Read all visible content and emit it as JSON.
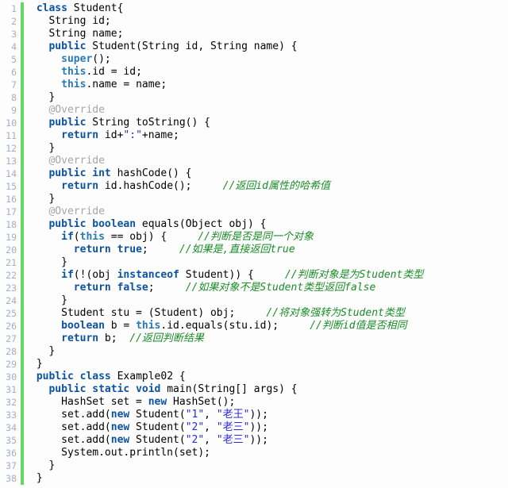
{
  "editor": {
    "name": "java-code-editor",
    "language": "Java",
    "total_lines": 38,
    "colors": {
      "background": "#fdfdfd",
      "gutter_text": "#a0b0c8",
      "change_marker": "#63d860",
      "keyword": "#0c52a3",
      "this_super": "#2b7ab5",
      "string": "#2a2ae0",
      "comment": "#1a8c28",
      "annotation": "#a6a6a6",
      "text": "#000000"
    }
  },
  "line_numbers": [
    1,
    2,
    3,
    4,
    5,
    6,
    7,
    8,
    9,
    10,
    11,
    12,
    13,
    14,
    15,
    16,
    17,
    18,
    19,
    20,
    21,
    22,
    23,
    24,
    25,
    26,
    27,
    28,
    29,
    30,
    31,
    32,
    33,
    34,
    35,
    36,
    37,
    38
  ],
  "lines": [
    {
      "n": 1,
      "tokens": [
        {
          "t": "plain",
          "v": " "
        },
        {
          "t": "kw",
          "v": "class"
        },
        {
          "t": "plain",
          "v": " Student{"
        }
      ]
    },
    {
      "n": 2,
      "tokens": [
        {
          "t": "plain",
          "v": "   String id;"
        }
      ]
    },
    {
      "n": 3,
      "tokens": [
        {
          "t": "plain",
          "v": "   String name;"
        }
      ]
    },
    {
      "n": 4,
      "tokens": [
        {
          "t": "plain",
          "v": "   "
        },
        {
          "t": "kw",
          "v": "public"
        },
        {
          "t": "plain",
          "v": " Student(String id, String name) {"
        }
      ]
    },
    {
      "n": 5,
      "tokens": [
        {
          "t": "plain",
          "v": "     "
        },
        {
          "t": "kw2",
          "v": "super"
        },
        {
          "t": "plain",
          "v": "();"
        }
      ]
    },
    {
      "n": 6,
      "tokens": [
        {
          "t": "plain",
          "v": "     "
        },
        {
          "t": "kw2",
          "v": "this"
        },
        {
          "t": "plain",
          "v": ".id = id;"
        }
      ]
    },
    {
      "n": 7,
      "tokens": [
        {
          "t": "plain",
          "v": "     "
        },
        {
          "t": "kw2",
          "v": "this"
        },
        {
          "t": "plain",
          "v": ".name = name;"
        }
      ]
    },
    {
      "n": 8,
      "tokens": [
        {
          "t": "plain",
          "v": "   }"
        }
      ]
    },
    {
      "n": 9,
      "tokens": [
        {
          "t": "plain",
          "v": "   "
        },
        {
          "t": "anno",
          "v": "@Override"
        }
      ]
    },
    {
      "n": 10,
      "tokens": [
        {
          "t": "plain",
          "v": "   "
        },
        {
          "t": "kw",
          "v": "public"
        },
        {
          "t": "plain",
          "v": " String toString() {"
        }
      ]
    },
    {
      "n": 11,
      "tokens": [
        {
          "t": "plain",
          "v": "     "
        },
        {
          "t": "kw",
          "v": "return"
        },
        {
          "t": "plain",
          "v": " id+"
        },
        {
          "t": "str",
          "v": "\":\""
        },
        {
          "t": "plain",
          "v": "+name;"
        }
      ]
    },
    {
      "n": 12,
      "tokens": [
        {
          "t": "plain",
          "v": "   }"
        }
      ]
    },
    {
      "n": 13,
      "tokens": [
        {
          "t": "plain",
          "v": "   "
        },
        {
          "t": "anno",
          "v": "@Override"
        }
      ]
    },
    {
      "n": 14,
      "tokens": [
        {
          "t": "plain",
          "v": "   "
        },
        {
          "t": "kw",
          "v": "public"
        },
        {
          "t": "plain",
          "v": " "
        },
        {
          "t": "kw",
          "v": "int"
        },
        {
          "t": "plain",
          "v": " hashCode() {"
        }
      ]
    },
    {
      "n": 15,
      "tokens": [
        {
          "t": "plain",
          "v": "     "
        },
        {
          "t": "kw",
          "v": "return"
        },
        {
          "t": "plain",
          "v": " id.hashCode();     "
        },
        {
          "t": "cmt",
          "v": "//返回id属性的哈希值"
        }
      ]
    },
    {
      "n": 16,
      "tokens": [
        {
          "t": "plain",
          "v": "   }"
        }
      ]
    },
    {
      "n": 17,
      "tokens": [
        {
          "t": "plain",
          "v": "   "
        },
        {
          "t": "anno",
          "v": "@Override"
        }
      ]
    },
    {
      "n": 18,
      "tokens": [
        {
          "t": "plain",
          "v": "   "
        },
        {
          "t": "kw",
          "v": "public"
        },
        {
          "t": "plain",
          "v": " "
        },
        {
          "t": "kw",
          "v": "boolean"
        },
        {
          "t": "plain",
          "v": " equals(Object obj) {"
        }
      ]
    },
    {
      "n": 19,
      "tokens": [
        {
          "t": "plain",
          "v": "     "
        },
        {
          "t": "kw",
          "v": "if"
        },
        {
          "t": "plain",
          "v": "("
        },
        {
          "t": "kw2",
          "v": "this"
        },
        {
          "t": "plain",
          "v": " == obj) {     "
        },
        {
          "t": "cmt",
          "v": "//判断是否是同一个对象"
        }
      ]
    },
    {
      "n": 20,
      "tokens": [
        {
          "t": "plain",
          "v": "       "
        },
        {
          "t": "kw",
          "v": "return"
        },
        {
          "t": "plain",
          "v": " "
        },
        {
          "t": "kw",
          "v": "true"
        },
        {
          "t": "plain",
          "v": ";     "
        },
        {
          "t": "cmt",
          "v": "//如果是,直接返回true"
        }
      ]
    },
    {
      "n": 21,
      "tokens": [
        {
          "t": "plain",
          "v": "     }"
        }
      ]
    },
    {
      "n": 22,
      "tokens": [
        {
          "t": "plain",
          "v": "     "
        },
        {
          "t": "kw",
          "v": "if"
        },
        {
          "t": "plain",
          "v": "(!(obj "
        },
        {
          "t": "kw",
          "v": "instanceof"
        },
        {
          "t": "plain",
          "v": " Student)) {     "
        },
        {
          "t": "cmt",
          "v": "//判断对象是为Student类型"
        }
      ]
    },
    {
      "n": 23,
      "tokens": [
        {
          "t": "plain",
          "v": "       "
        },
        {
          "t": "kw",
          "v": "return"
        },
        {
          "t": "plain",
          "v": " "
        },
        {
          "t": "kw",
          "v": "false"
        },
        {
          "t": "plain",
          "v": ";     "
        },
        {
          "t": "cmt",
          "v": "//如果对象不是Student类型返回false"
        }
      ]
    },
    {
      "n": 24,
      "tokens": [
        {
          "t": "plain",
          "v": "     }"
        }
      ]
    },
    {
      "n": 25,
      "tokens": [
        {
          "t": "plain",
          "v": "     Student stu = (Student) obj;     "
        },
        {
          "t": "cmt",
          "v": "//将对象强转为Student类型"
        }
      ]
    },
    {
      "n": 26,
      "tokens": [
        {
          "t": "plain",
          "v": "     "
        },
        {
          "t": "kw",
          "v": "boolean"
        },
        {
          "t": "plain",
          "v": " b = "
        },
        {
          "t": "kw2",
          "v": "this"
        },
        {
          "t": "plain",
          "v": ".id.equals(stu.id);     "
        },
        {
          "t": "cmt",
          "v": "//判断id值是否相同"
        }
      ]
    },
    {
      "n": 27,
      "tokens": [
        {
          "t": "plain",
          "v": "     "
        },
        {
          "t": "kw",
          "v": "return"
        },
        {
          "t": "plain",
          "v": " b;  "
        },
        {
          "t": "cmt",
          "v": "//返回判断结果"
        }
      ]
    },
    {
      "n": 28,
      "tokens": [
        {
          "t": "plain",
          "v": "   }"
        }
      ]
    },
    {
      "n": 29,
      "tokens": [
        {
          "t": "plain",
          "v": " }"
        }
      ]
    },
    {
      "n": 30,
      "tokens": [
        {
          "t": "plain",
          "v": " "
        },
        {
          "t": "kw",
          "v": "public"
        },
        {
          "t": "plain",
          "v": " "
        },
        {
          "t": "kw",
          "v": "class"
        },
        {
          "t": "plain",
          "v": " Example02 {"
        }
      ]
    },
    {
      "n": 31,
      "tokens": [
        {
          "t": "plain",
          "v": "   "
        },
        {
          "t": "kw",
          "v": "public"
        },
        {
          "t": "plain",
          "v": " "
        },
        {
          "t": "kw",
          "v": "static"
        },
        {
          "t": "plain",
          "v": " "
        },
        {
          "t": "kw",
          "v": "void"
        },
        {
          "t": "plain",
          "v": " main(String[] args) {"
        }
      ]
    },
    {
      "n": 32,
      "tokens": [
        {
          "t": "plain",
          "v": "     HashSet set = "
        },
        {
          "t": "kw",
          "v": "new"
        },
        {
          "t": "plain",
          "v": " HashSet();"
        }
      ]
    },
    {
      "n": 33,
      "tokens": [
        {
          "t": "plain",
          "v": "     set.add("
        },
        {
          "t": "kw",
          "v": "new"
        },
        {
          "t": "plain",
          "v": " Student("
        },
        {
          "t": "str",
          "v": "\"1\""
        },
        {
          "t": "plain",
          "v": ", "
        },
        {
          "t": "str",
          "v": "\"老王\""
        },
        {
          "t": "plain",
          "v": "));"
        }
      ]
    },
    {
      "n": 34,
      "tokens": [
        {
          "t": "plain",
          "v": "     set.add("
        },
        {
          "t": "kw",
          "v": "new"
        },
        {
          "t": "plain",
          "v": " Student("
        },
        {
          "t": "str",
          "v": "\"2\""
        },
        {
          "t": "plain",
          "v": ", "
        },
        {
          "t": "str",
          "v": "\"老三\""
        },
        {
          "t": "plain",
          "v": "));"
        }
      ]
    },
    {
      "n": 35,
      "tokens": [
        {
          "t": "plain",
          "v": "     set.add("
        },
        {
          "t": "kw",
          "v": "new"
        },
        {
          "t": "plain",
          "v": " Student("
        },
        {
          "t": "str",
          "v": "\"2\""
        },
        {
          "t": "plain",
          "v": ", "
        },
        {
          "t": "str",
          "v": "\"老三\""
        },
        {
          "t": "plain",
          "v": "));"
        }
      ]
    },
    {
      "n": 36,
      "tokens": [
        {
          "t": "plain",
          "v": "     System.out.println(set);"
        }
      ]
    },
    {
      "n": 37,
      "tokens": [
        {
          "t": "plain",
          "v": "   }"
        }
      ]
    },
    {
      "n": 38,
      "tokens": [
        {
          "t": "plain",
          "v": " }"
        }
      ]
    }
  ]
}
